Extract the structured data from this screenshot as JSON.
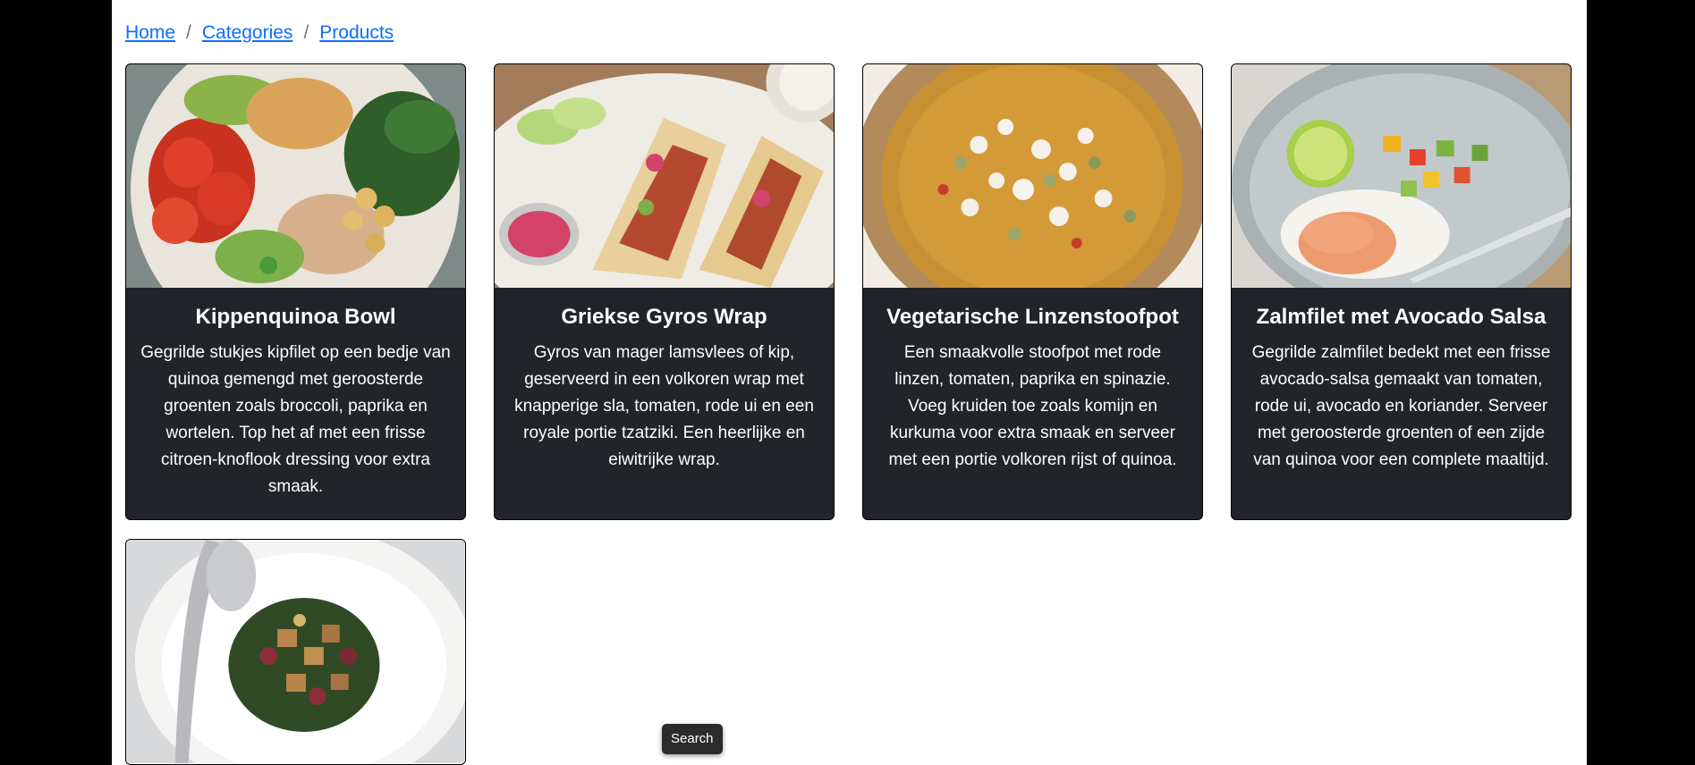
{
  "breadcrumb": {
    "items": [
      "Home",
      "Categories",
      "Products"
    ],
    "separator": "/"
  },
  "products": [
    {
      "title": "Kippenquinoa Bowl",
      "description": "Gegrilde stukjes kipfilet op een bedje van quinoa gemengd met geroosterde groenten zoals broccoli, paprika en wortelen. Top het af met een frisse citroen-knoflook dressing voor extra smaak."
    },
    {
      "title": "Griekse Gyros Wrap",
      "description": "Gyros van mager lamsvlees of kip, geserveerd in een volkoren wrap met knapperige sla, tomaten, rode ui en een royale portie tzatziki. Een heerlijke en eiwitrijke wrap."
    },
    {
      "title": "Vegetarische Linzenstoofpot",
      "description": "Een smaakvolle stoofpot met rode linzen, tomaten, paprika en spinazie. Voeg kruiden toe zoals komijn en kurkuma voor extra smaak en serveer met een portie volkoren rijst of quinoa."
    },
    {
      "title": "Zalmfilet met Avocado Salsa",
      "description": "Gegrilde zalmfilet bedekt met een frisse avocado-salsa gemaakt van tomaten, rode ui, avocado en koriander. Serveer met geroosterde groenten of een zijde van quinoa voor een complete maaltijd."
    }
  ],
  "search_button": "Search",
  "colors": {
    "card_bg": "#212529",
    "link": "#0d6efd",
    "outer_bg": "#000000"
  }
}
